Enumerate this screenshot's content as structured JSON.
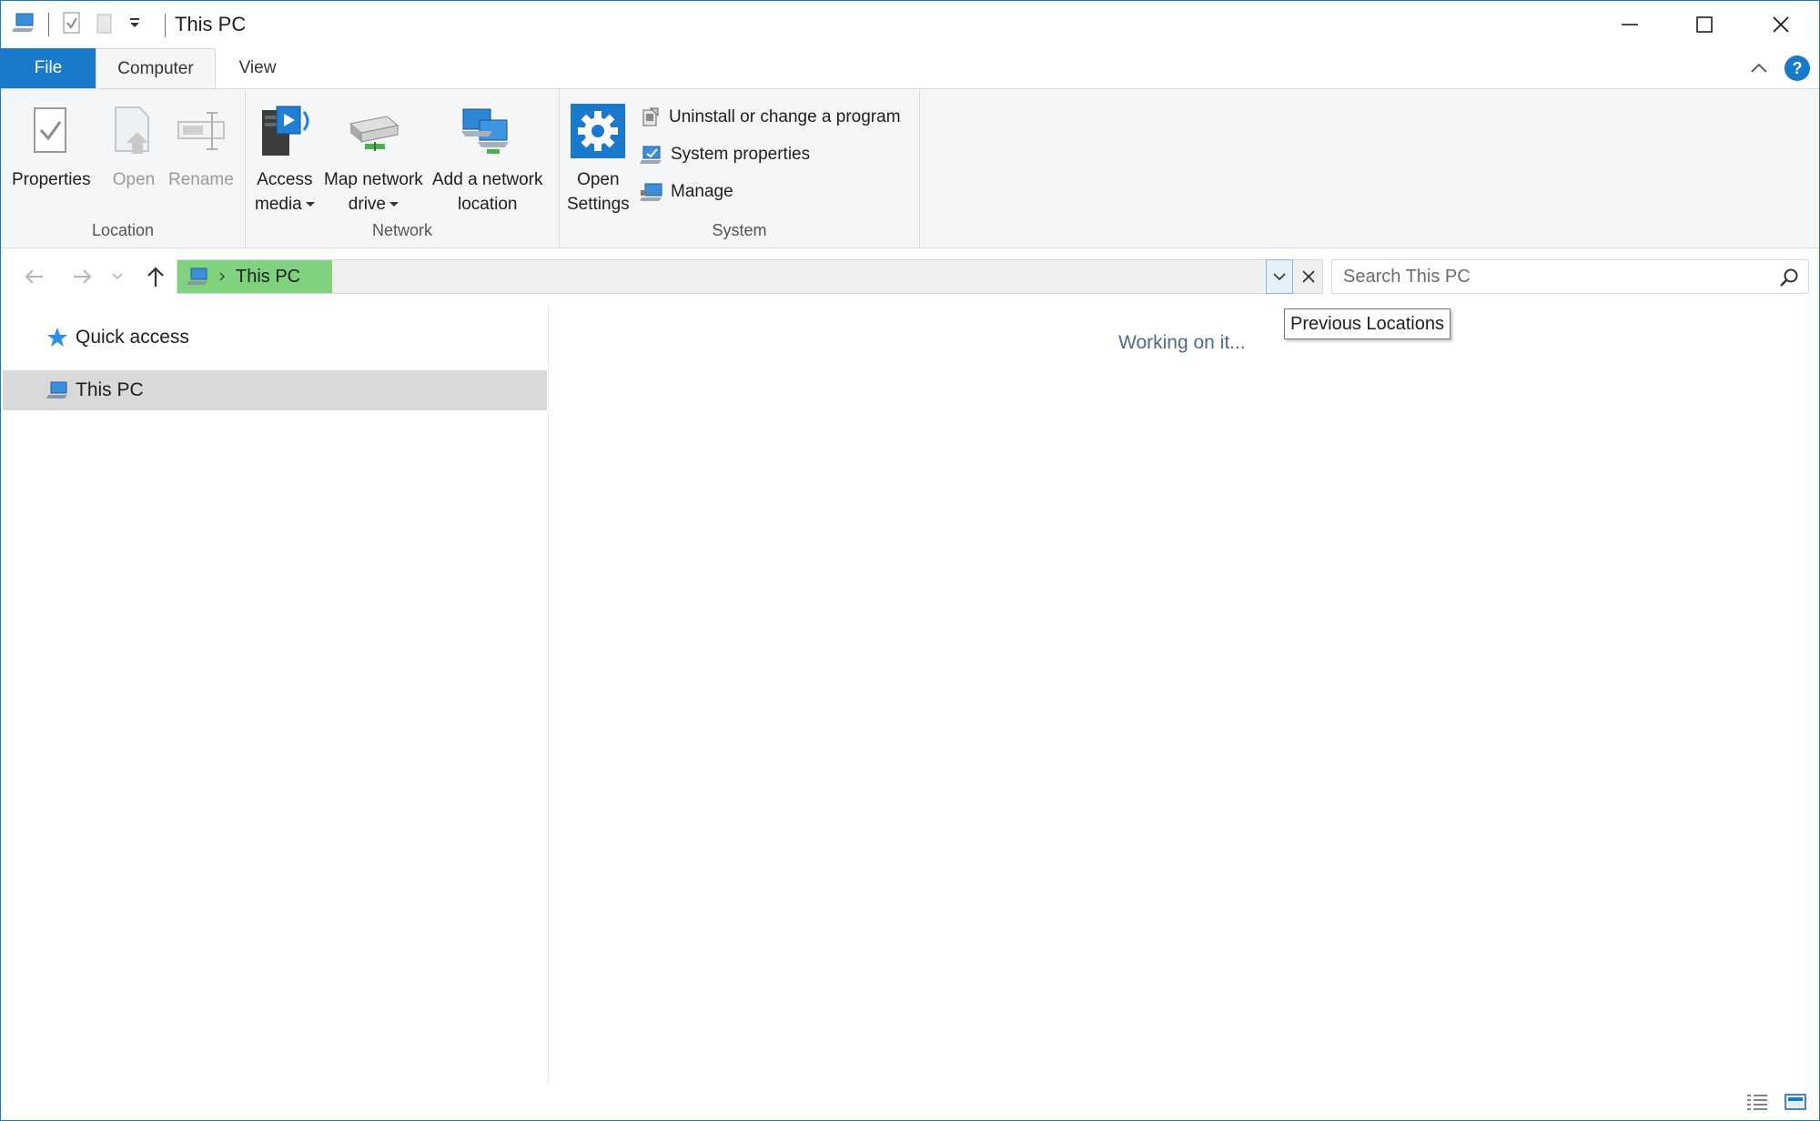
{
  "window": {
    "title": "This PC"
  },
  "ribbon_tabs": [
    {
      "label": "File"
    },
    {
      "label": "Computer"
    },
    {
      "label": "View"
    }
  ],
  "ribbon": {
    "location": {
      "label": "Location",
      "properties": "Properties",
      "open": "Open",
      "rename": "Rename"
    },
    "network": {
      "label": "Network",
      "access_media_1": "Access",
      "access_media_2": "media",
      "map_drive_1": "Map network",
      "map_drive_2": "drive",
      "add_location_1": "Add a network",
      "add_location_2": "location"
    },
    "system": {
      "label": "System",
      "open_settings_1": "Open",
      "open_settings_2": "Settings",
      "uninstall": "Uninstall or change a program",
      "system_properties": "System properties",
      "manage": "Manage"
    }
  },
  "address": {
    "crumb": "This PC",
    "search_placeholder": "Search This PC",
    "tooltip": "Previous Locations"
  },
  "nav_pane": {
    "items": [
      {
        "label": "Quick access"
      },
      {
        "label": "This PC"
      }
    ]
  },
  "content": {
    "status": "Working on it..."
  },
  "colors": {
    "accent": "#1979ca",
    "crumb_highlight": "#7fd37f",
    "selected": "#d9d9d9"
  }
}
